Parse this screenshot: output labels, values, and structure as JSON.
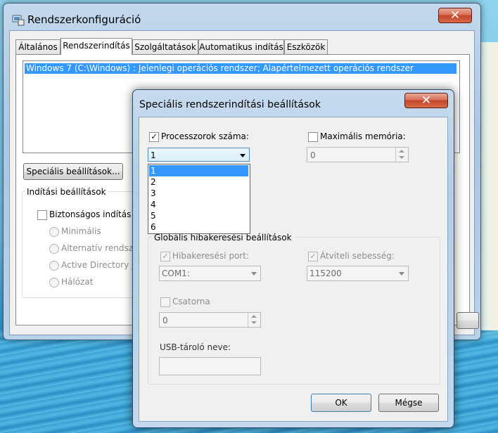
{
  "main_window": {
    "title": "Rendszerkonfiguráció",
    "close_glyph": "✕",
    "tabs": [
      "Általános",
      "Rendszerindítás",
      "Szolgáltatások",
      "Automatikus indítás",
      "Eszközök"
    ],
    "active_tab": "Rendszerindítás",
    "os_entry": "Windows 7 (C:\\Windows) : Jelenlegi operációs rendszer; Alapértelmezett operációs rendszer",
    "advanced_button": "Speciális beállítások...",
    "boot_options_group": "Indítási beállítások",
    "safe_boot_label": "Biztonságos indítás",
    "radios": [
      "Minimális",
      "Alternatív rendsz",
      "Active Directory j",
      "Hálózat"
    ]
  },
  "dialog": {
    "title": "Speciális rendszerindítási beállítások",
    "close_glyph": "✕",
    "num_processors_label": "Processzorok száma:",
    "num_processors_checked": true,
    "num_processors_value": "1",
    "processor_options": [
      "1",
      "2",
      "3",
      "4",
      "5",
      "6"
    ],
    "max_memory_label": "Maximális memória:",
    "max_memory_checked": false,
    "max_memory_value": "0",
    "debug_group": "Globális hibakeresési beállítások",
    "debug_port_label": "Hibakeresési port:",
    "debug_port_value": "COM1:",
    "baud_rate_label": "Átviteli sebesség:",
    "baud_rate_value": "115200",
    "channel_label": "Csatorna",
    "channel_value": "0",
    "usb_target_label": "USB-tároló neve:",
    "ok_button": "OK",
    "cancel_button": "Mégse",
    "checkmark": "✓"
  },
  "colors": {
    "selection": "#3399ff",
    "close_red": "#c24629"
  }
}
